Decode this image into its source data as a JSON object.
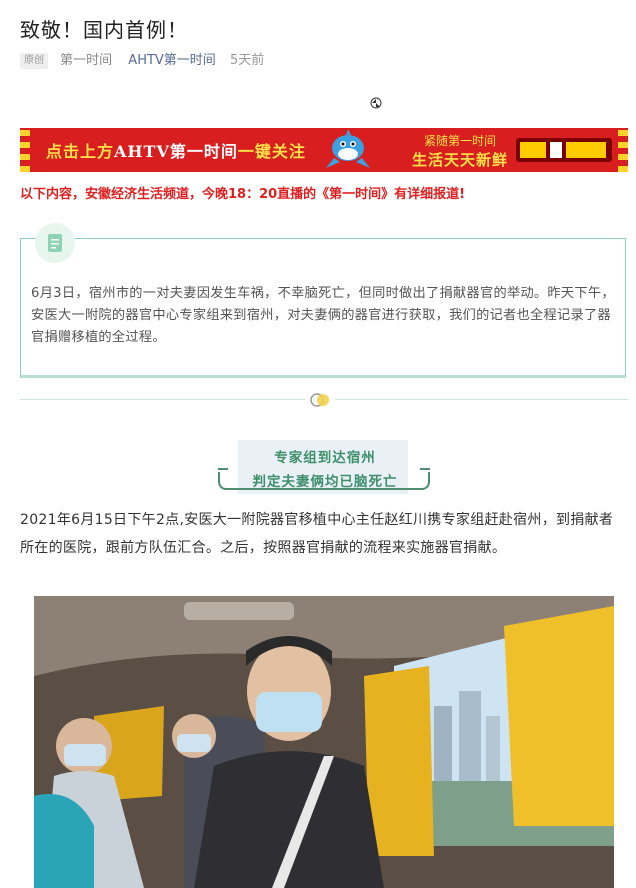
{
  "article": {
    "title": "致敬！国内首例！",
    "tag": "原创",
    "source_time": "第一时间",
    "account": "AHTV第一时间",
    "time_ago": "5天前"
  },
  "banner": {
    "left_text_pre": "点击上方",
    "left_text_highlight": "AHTV第一时间",
    "left_text_post": "一键关注",
    "right_line1": "紧随第一时间",
    "right_line2": "生活天天新鲜"
  },
  "notice": "以下内容，安徽经济生活频道，今晚18：20直播的《第一时间》有详细报道!",
  "summary": "6月3日，宿州市的一对夫妻因发生车祸，不幸脑死亡，但同时做出了捐献器官的举动。昨天下午，安医大一附院的器官中心专家组来到宿州，对夫妻俩的器官进行获取，我们的记者也全程记录了器官捐赠移植的全过程。",
  "section": {
    "heading_line1": "专家组到达宿州",
    "heading_line2": "判定夫妻俩均已脑死亡"
  },
  "paragraph": "2021年6月15日下午2点,安医大一附院器官移植中心主任赵红川携专家组赶赴宿州，到捐献者所在的医院，跟前方队伍汇合。之后，按照器官捐献的流程来实施器官捐献。",
  "colors": {
    "banner_red": "#d81e1e",
    "banner_yellow": "#ffe14a",
    "notice_red": "#e02020",
    "accent_green": "#3f8f6b",
    "link_blue": "#576b95"
  },
  "icons": {
    "summary_badge": "document-icon",
    "divider": "ring-icon"
  }
}
